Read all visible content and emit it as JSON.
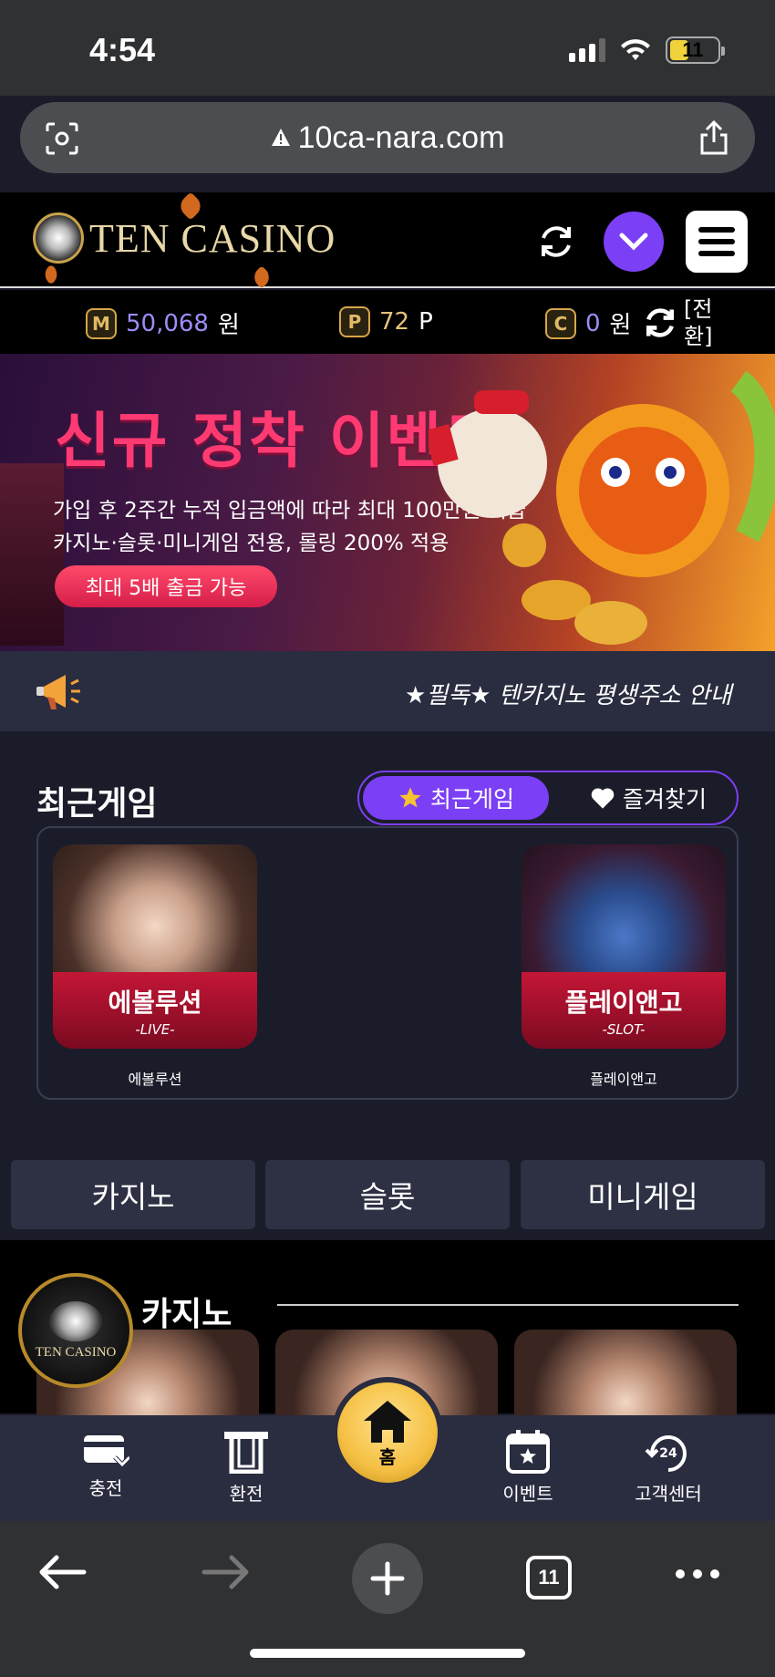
{
  "status_bar": {
    "time": "4:54",
    "battery": "11"
  },
  "browser": {
    "url": "10ca-nara.com",
    "tab_count": "11"
  },
  "header": {
    "logo_text": "TEN CASINO"
  },
  "balances": [
    {
      "badge": "M",
      "value": "50,068",
      "unit": "원"
    },
    {
      "badge": "P",
      "value": "72",
      "unit": "P"
    },
    {
      "badge": "C",
      "value": "0",
      "unit": "원"
    }
  ],
  "exchange_label": "[전환]",
  "banner": {
    "title": "신규 정착 이벤트",
    "line1": "가입 후 2주간 누적 입금액에 따라 최대 100만원 지급",
    "line2": "카지노·슬롯·미니게임 전용, 롤링 200% 적용",
    "button": "최대 5배 출금 가능"
  },
  "notice": {
    "text": "★필독★ 텐카지노 평생주소 안내"
  },
  "recent": {
    "title": "최근게임",
    "tab_recent": "최근게임",
    "tab_favorite": "즐겨찾기",
    "games": [
      {
        "card_name": "에볼루션",
        "card_type": "-LIVE-",
        "label": "에볼루션"
      },
      {
        "card_name": "플레이앤고",
        "card_type": "-SLOT-",
        "label": "플레이앤고"
      }
    ]
  },
  "categories": [
    "카지노",
    "슬롯",
    "미니게임"
  ],
  "live_section": {
    "title": "카지노"
  },
  "float_logo_text": "TEN CASINO",
  "tab_bar": {
    "charge": "충전",
    "withdraw": "환전",
    "home": "홈",
    "event": "이벤트",
    "support": "고객센터"
  },
  "colors": {
    "accent": "#7b3ff5",
    "banner_title": "#ff3a73",
    "gold": "#f5c043"
  }
}
